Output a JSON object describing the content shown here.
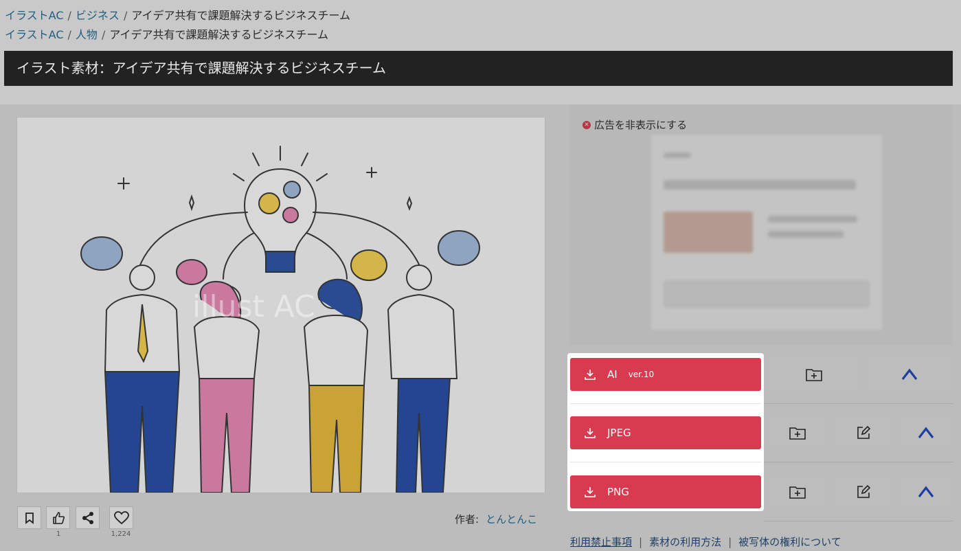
{
  "breadcrumbs": [
    {
      "items": [
        "イラストAC",
        "ビジネス"
      ],
      "current": "アイデア共有で課題解決するビジネスチーム"
    },
    {
      "items": [
        "イラストAC",
        "人物"
      ],
      "current": "アイデア共有で課題解決するビジネスチーム"
    }
  ],
  "page_title": "イラスト素材：アイデア共有で課題解決するビジネスチーム",
  "preview": {
    "watermark": "illust AC"
  },
  "actions": {
    "like_count": "1",
    "favorite_count": "1,224"
  },
  "author": {
    "label": "作者:",
    "name": "とんとんこ"
  },
  "ads": {
    "hide_label": "広告を非表示にする"
  },
  "downloads": [
    {
      "format": "AI",
      "version": "ver.10"
    },
    {
      "format": "JPEG",
      "version": ""
    },
    {
      "format": "PNG",
      "version": ""
    }
  ],
  "footer": {
    "links": [
      "利用禁止事項",
      "素材の利用方法",
      "被写体の権利について"
    ]
  },
  "colors": {
    "accent": "#d83a4f",
    "link": "#1f5e80",
    "title_bg": "#222222",
    "chevron": "#1d3fa0"
  }
}
